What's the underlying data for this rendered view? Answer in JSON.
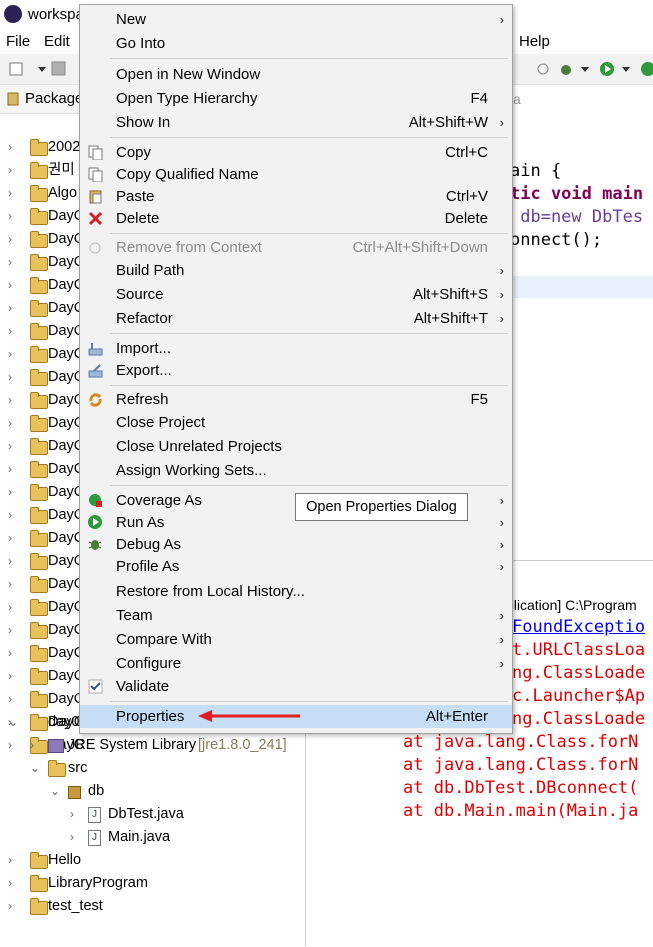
{
  "window": {
    "title": "workspa"
  },
  "menubar": {
    "file": "File",
    "edit": "Edit",
    "help": "Help"
  },
  "explorer": {
    "tab_label": "Package",
    "items": [
      {
        "label": "2002"
      },
      {
        "label": "권미"
      },
      {
        "label": "Algo"
      },
      {
        "label": "DayC"
      },
      {
        "label": "DayC"
      },
      {
        "label": "DayC"
      },
      {
        "label": "DayC"
      },
      {
        "label": "DayC"
      },
      {
        "label": "DayC"
      },
      {
        "label": "DayC"
      },
      {
        "label": "DayC"
      },
      {
        "label": "DayC"
      },
      {
        "label": "DayC"
      },
      {
        "label": "DayC"
      },
      {
        "label": "DayC"
      },
      {
        "label": "DayC"
      },
      {
        "label": "DayC"
      },
      {
        "label": "DayC"
      },
      {
        "label": "DayC"
      },
      {
        "label": "DayC"
      },
      {
        "label": "DayC"
      },
      {
        "label": "DayC"
      },
      {
        "label": "DayC"
      },
      {
        "label": "DayC"
      },
      {
        "label": "DayC"
      },
      {
        "label": "DayC"
      },
      {
        "label": "DayC"
      }
    ],
    "expanded_project": "day0",
    "jre": "JRE System Library",
    "jre_version": "[jre1.8.0_241]",
    "src": "src",
    "pkg": "db",
    "file1": "DbTest.java",
    "file2": "Main.java",
    "bottom_items": [
      {
        "label": "Hello"
      },
      {
        "label": "LibraryProgram"
      },
      {
        "label": "test_test"
      }
    ]
  },
  "editor": {
    "tab_hint": "va",
    "line1": "ain {",
    "line2": "tic void main",
    "line3": " db=new DbTes",
    "line4": "onnect();"
  },
  "console": {
    "header": "plication] C:\\Program",
    "lines": [
      "FoundExceptio",
      "t.URLClassLoa",
      "ng.ClassLoade",
      "c.Launcher$Ap",
      "ng.ClassLoade",
      "at java.lang.Class.forN",
      "at java.lang.Class.forN",
      "at db.DbTest.DBconnect(",
      "at db.Main.main(Main.ja"
    ]
  },
  "context_menu": {
    "new": "New",
    "go_into": "Go Into",
    "open_new_window": "Open in New Window",
    "open_type_hierarchy": "Open Type Hierarchy",
    "open_type_hierarchy_key": "F4",
    "show_in": "Show In",
    "show_in_key": "Alt+Shift+W",
    "copy": "Copy",
    "copy_key": "Ctrl+C",
    "copy_qualified": "Copy Qualified Name",
    "paste": "Paste",
    "paste_key": "Ctrl+V",
    "delete": "Delete",
    "delete_key": "Delete",
    "remove_context": "Remove from Context",
    "remove_context_key": "Ctrl+Alt+Shift+Down",
    "build_path": "Build Path",
    "source": "Source",
    "source_key": "Alt+Shift+S",
    "refactor": "Refactor",
    "refactor_key": "Alt+Shift+T",
    "import": "Import...",
    "export": "Export...",
    "refresh": "Refresh",
    "refresh_key": "F5",
    "close_project": "Close Project",
    "close_unrelated": "Close Unrelated Projects",
    "assign_sets": "Assign Working Sets...",
    "coverage_as": "Coverage As",
    "run_as": "Run As",
    "debug_as": "Debug As",
    "profile_as": "Profile As",
    "restore_history": "Restore from Local History...",
    "team": "Team",
    "compare_with": "Compare With",
    "configure": "Configure",
    "validate": "Validate",
    "properties": "Properties",
    "properties_key": "Alt+Enter"
  },
  "tooltip": {
    "text": "Open Properties Dialog"
  },
  "colors": {
    "highlight": "#c5def5",
    "arrow": "#e02020",
    "keyword": "#7f0055",
    "error": "#e00000",
    "link": "#0000ee"
  }
}
